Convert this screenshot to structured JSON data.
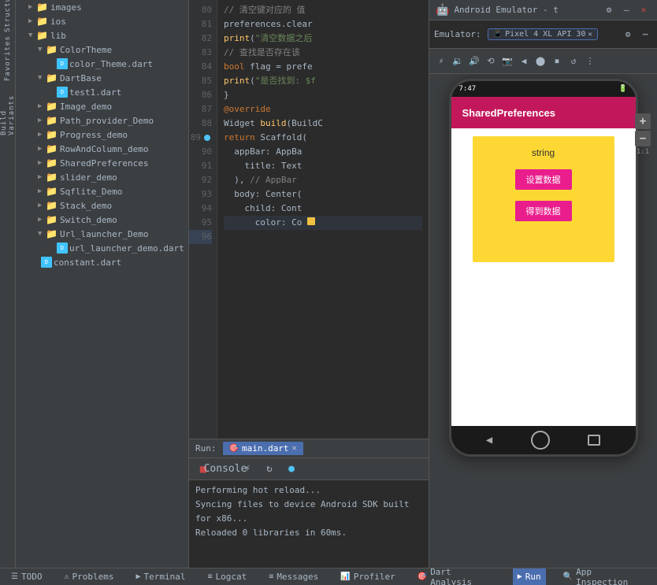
{
  "emulator": {
    "title": "Android Emulator - t",
    "emulator_label": "Emulator:",
    "device": "Pixel 4 XL API 30",
    "app_title": "SharedPreferences",
    "status_time": "7:47",
    "string_label": "string",
    "btn1": "设置数据",
    "btn2": "得到数据"
  },
  "editor": {
    "lines": [
      {
        "num": "80",
        "content": "// 清空键对应的 值"
      },
      {
        "num": "81",
        "content": "preferences.clear"
      },
      {
        "num": "82",
        "content": "print(\"清空数据之后"
      },
      {
        "num": "83",
        "content": "// 查找是否存在该"
      },
      {
        "num": "84",
        "content": "bool flag = prefe"
      },
      {
        "num": "85",
        "content": "print(\"是否找到: $f"
      },
      {
        "num": "86",
        "content": "}"
      },
      {
        "num": "87",
        "content": ""
      },
      {
        "num": "88",
        "content": "@override"
      },
      {
        "num": "89",
        "content": "Widget build(BuildC"
      },
      {
        "num": "90",
        "content": "return Scaffold("
      },
      {
        "num": "91",
        "content": "appBar: AppBa"
      },
      {
        "num": "92",
        "content": "title: Text"
      },
      {
        "num": "93",
        "content": "), // AppBar"
      },
      {
        "num": "94",
        "content": "body: Center("
      },
      {
        "num": "95",
        "content": "child: Cont"
      },
      {
        "num": "96",
        "content": "color: Co"
      }
    ]
  },
  "run_bar": {
    "label": "Run:",
    "tab": "main.dart"
  },
  "console": {
    "tab": "Console",
    "lines": [
      "Performing hot reload...",
      "Syncing files to device Android SDK built for x86...",
      "Reloaded 0 libraries in 60ms."
    ]
  },
  "sidebar": {
    "items": [
      {
        "label": "images",
        "indent": 1,
        "type": "folder",
        "expanded": false
      },
      {
        "label": "ios",
        "indent": 1,
        "type": "folder",
        "expanded": false
      },
      {
        "label": "lib",
        "indent": 1,
        "type": "folder",
        "expanded": true
      },
      {
        "label": "ColorTheme",
        "indent": 2,
        "type": "folder",
        "expanded": true
      },
      {
        "label": "color_Theme.dart",
        "indent": 3,
        "type": "dart"
      },
      {
        "label": "DartBase",
        "indent": 2,
        "type": "folder",
        "expanded": true
      },
      {
        "label": "test1.dart",
        "indent": 3,
        "type": "dart"
      },
      {
        "label": "Image_demo",
        "indent": 2,
        "type": "folder",
        "expanded": false
      },
      {
        "label": "Path_provider_Demo",
        "indent": 2,
        "type": "folder",
        "expanded": false
      },
      {
        "label": "Progress_demo",
        "indent": 2,
        "type": "folder",
        "expanded": false
      },
      {
        "label": "RowAndColumn_demo",
        "indent": 2,
        "type": "folder",
        "expanded": false
      },
      {
        "label": "SharedPreferences",
        "indent": 2,
        "type": "folder",
        "expanded": false
      },
      {
        "label": "slider_demo",
        "indent": 2,
        "type": "folder",
        "expanded": false
      },
      {
        "label": "Sqflite_Demo",
        "indent": 2,
        "type": "folder",
        "expanded": false
      },
      {
        "label": "Stack_demo",
        "indent": 2,
        "type": "folder",
        "expanded": false
      },
      {
        "label": "Switch_demo",
        "indent": 2,
        "type": "folder",
        "expanded": false
      },
      {
        "label": "Url_launcher_Demo",
        "indent": 2,
        "type": "folder",
        "expanded": true
      },
      {
        "label": "url_launcher_demo.dart",
        "indent": 3,
        "type": "dart"
      },
      {
        "label": "constant.dart",
        "indent": 2,
        "type": "dart"
      }
    ]
  },
  "status_bar": {
    "todo": "TODO",
    "problems": "Problems",
    "terminal": "Terminal",
    "logcat": "Logcat",
    "messages": "Messages",
    "profiler": "Profiler",
    "dart_analysis": "Dart Analysis",
    "run": "Run",
    "app_inspection": "App Inspection"
  }
}
